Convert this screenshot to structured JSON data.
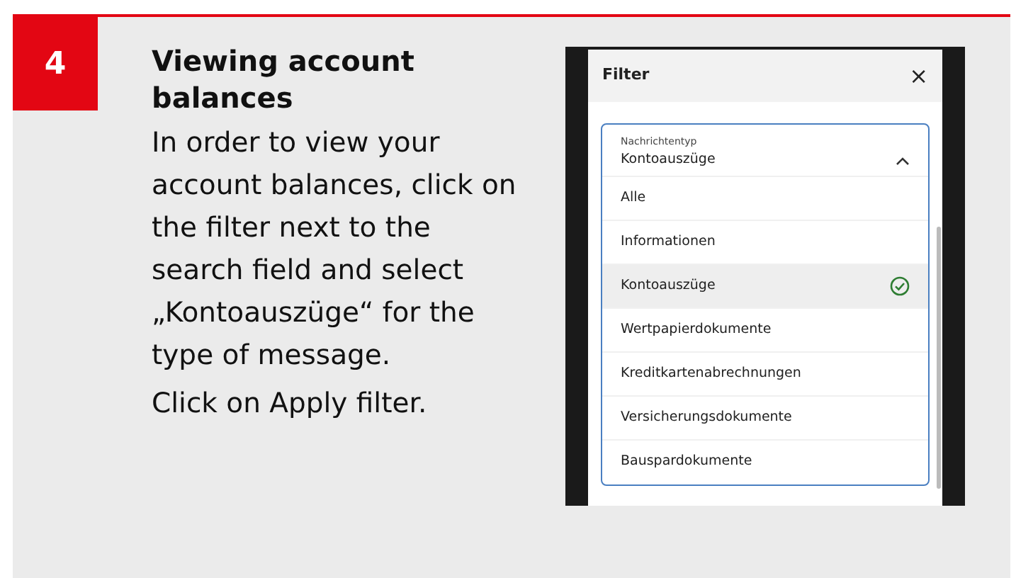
{
  "step": {
    "number": "4",
    "title": "Viewing account balances",
    "body": "In order to view your account balances, click on the filter next to the search field and select „Kontoauszüge“ for the type of message.",
    "note": "Click on Apply filter."
  },
  "phone": {
    "title": "Filter",
    "close": "×",
    "dropdown": {
      "label": "Nachrichtentyp",
      "value": "Kontoauszüge",
      "expanded": true,
      "options": [
        {
          "label": "Alle",
          "selected": false
        },
        {
          "label": "Informationen",
          "selected": false
        },
        {
          "label": "Kontoauszüge",
          "selected": true
        },
        {
          "label": "Wertpapierdokumente",
          "selected": false
        },
        {
          "label": "Kreditkartenabrechnungen",
          "selected": false
        },
        {
          "label": "Versicherungsdokumente",
          "selected": false
        },
        {
          "label": "Bauspardokumente",
          "selected": false
        }
      ]
    }
  }
}
